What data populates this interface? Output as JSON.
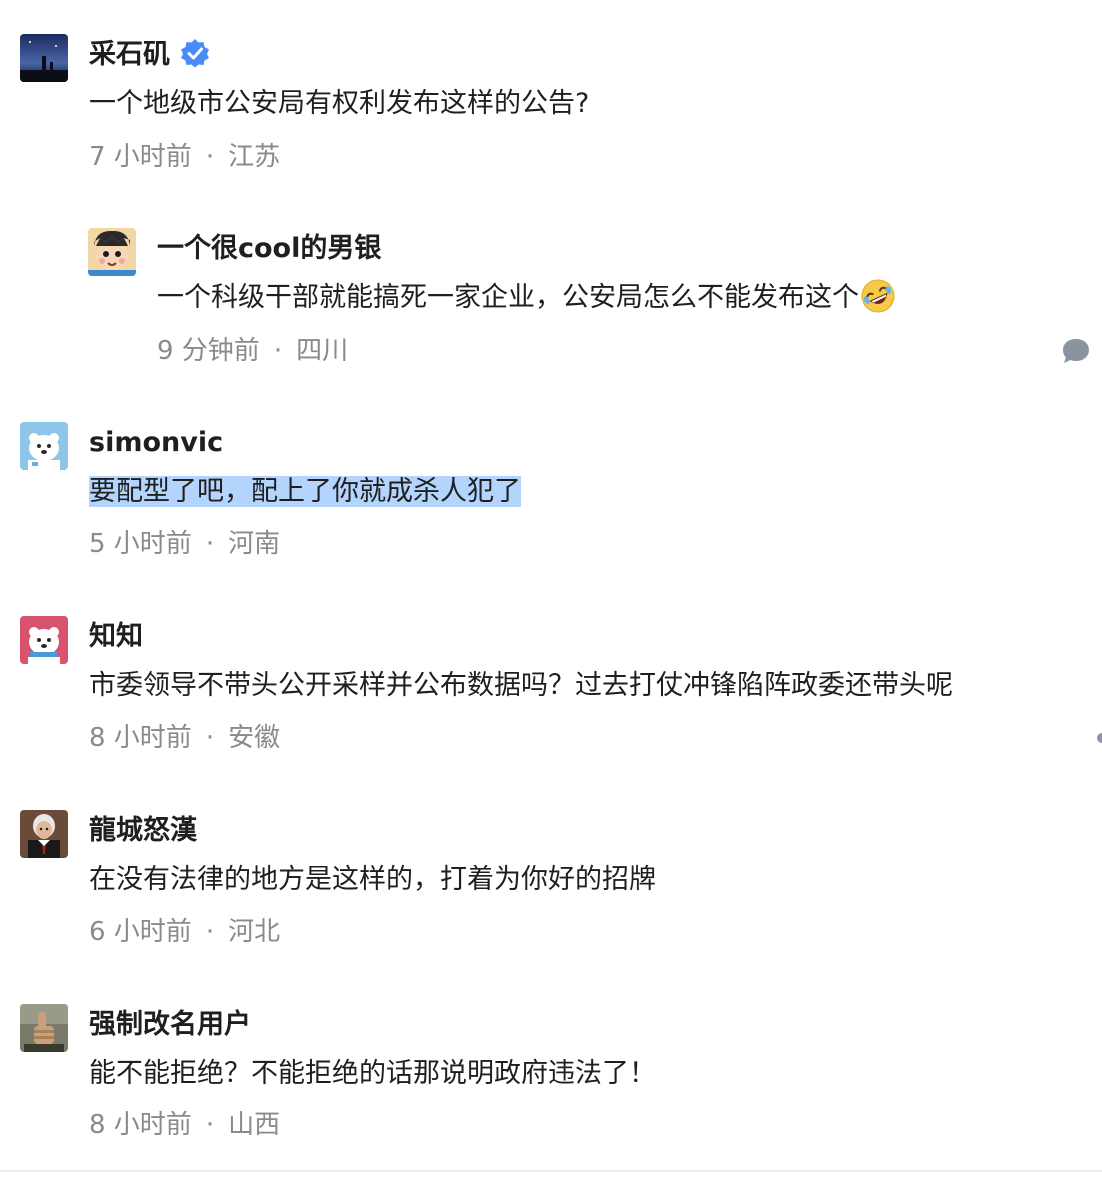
{
  "comments": [
    {
      "author": "采石矶",
      "verified": true,
      "text": "一个地级市公安局有权利发布这样的公告?",
      "time": "7 小时前",
      "location": "江苏",
      "reply": {
        "author": "一个很cool的男银",
        "text": "一个科级干部就能搞死一家企业，公安局怎么不能发布这个",
        "emoji": "rolling-on-floor-laughing-emoji",
        "time": "9 分钟前",
        "location": "四川"
      }
    },
    {
      "author": "simonvic",
      "text": "要配型了吧，配上了你就成杀人犯了",
      "highlighted": true,
      "time": "5 小时前",
      "location": "河南"
    },
    {
      "author": "知知",
      "text": "市委领导不带头公开采样并公布数据吗？过去打仗冲锋陷阵政委还带头呢",
      "time": "8 小时前",
      "location": "安徽"
    },
    {
      "author": "龍城怒漢",
      "text": "在没有法律的地方是这样的，打着为你好的招牌",
      "time": "6 小时前",
      "location": "河北"
    },
    {
      "author": "强制改名用户",
      "text": "能不能拒绝？不能拒绝的话那说明政府违法了！",
      "time": "8 小时前",
      "location": "山西"
    }
  ],
  "separator": "·",
  "icons": {
    "verified": "verified-badge-icon",
    "reply": "comment-bubble-icon"
  },
  "colors": {
    "highlight": "#b3d4fc",
    "meta": "#8a8a8a",
    "verified": "#4a8cf7"
  }
}
